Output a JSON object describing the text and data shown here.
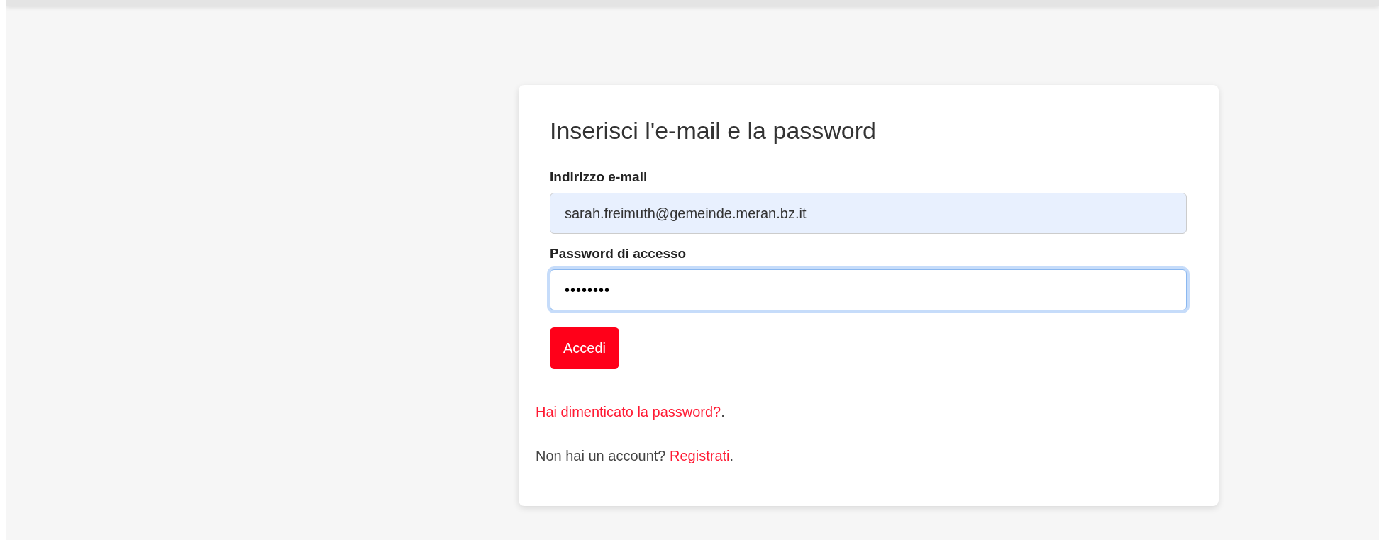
{
  "login_card": {
    "title": "Inserisci l'e-mail e la password",
    "fields": [
      {
        "label": "Indirizzo e-mail",
        "value": "sarah.freimuth@gemeinde.meran.bz.it",
        "autofilled": true,
        "focused": false
      },
      {
        "label": "Password di accesso",
        "value": "••••••••",
        "autofilled": false,
        "focused": true
      }
    ],
    "submit_button": "Accedi",
    "links": [
      {
        "link": "Hai dimenticato la password?",
        "after": "."
      },
      {
        "before": "Non hai un account? ",
        "link": "Registrati",
        "after": "."
      }
    ]
  }
}
